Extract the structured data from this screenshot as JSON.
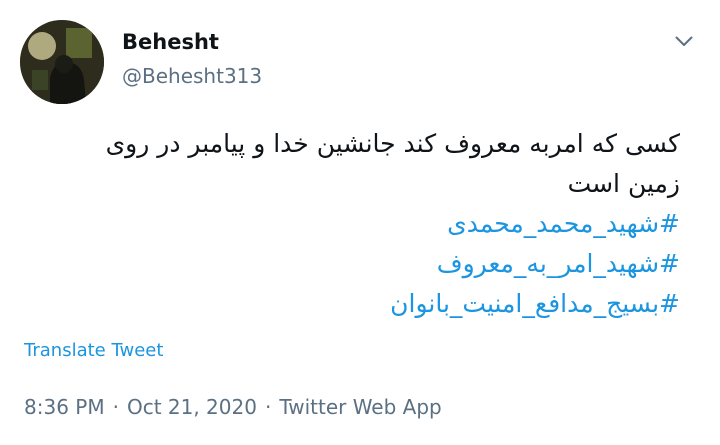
{
  "user": {
    "display_name": "Behesht",
    "handle": "@Behesht313"
  },
  "menu": {
    "icon": "chevron-down-icon"
  },
  "tweet": {
    "lines": [
      "کسی که امربه معروف کند جانشین خدا و پیامبر در روی",
      "زمین است"
    ],
    "hashtags": [
      "#شهید_محمد_محمدی",
      "#شهید_امر_به_معروف",
      "#بسیج_مدافع_امنیت_بانوان"
    ]
  },
  "translate_label": "Translate Tweet",
  "meta": {
    "time": "8:36 PM",
    "separator": "·",
    "date": "Oct 21, 2020",
    "source": "Twitter Web App"
  },
  "colors": {
    "link": "#1b95e0",
    "secondary": "#5b7083",
    "text": "#0f1419"
  }
}
